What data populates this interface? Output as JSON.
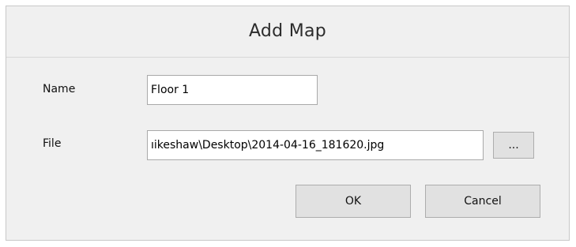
{
  "dialog": {
    "title": "Add Map"
  },
  "form": {
    "name_label": "Name",
    "name_value": "Floor 1",
    "file_label": "File",
    "file_value": "ıikeshaw\\Desktop\\2014-04-16_181620.jpg",
    "browse_label": "..."
  },
  "buttons": {
    "ok_label": "OK",
    "cancel_label": "Cancel"
  },
  "colors": {
    "dialog_bg": "#f0f0f0",
    "button_bg": "#e1e1e1",
    "field_bg": "#ffffff"
  }
}
